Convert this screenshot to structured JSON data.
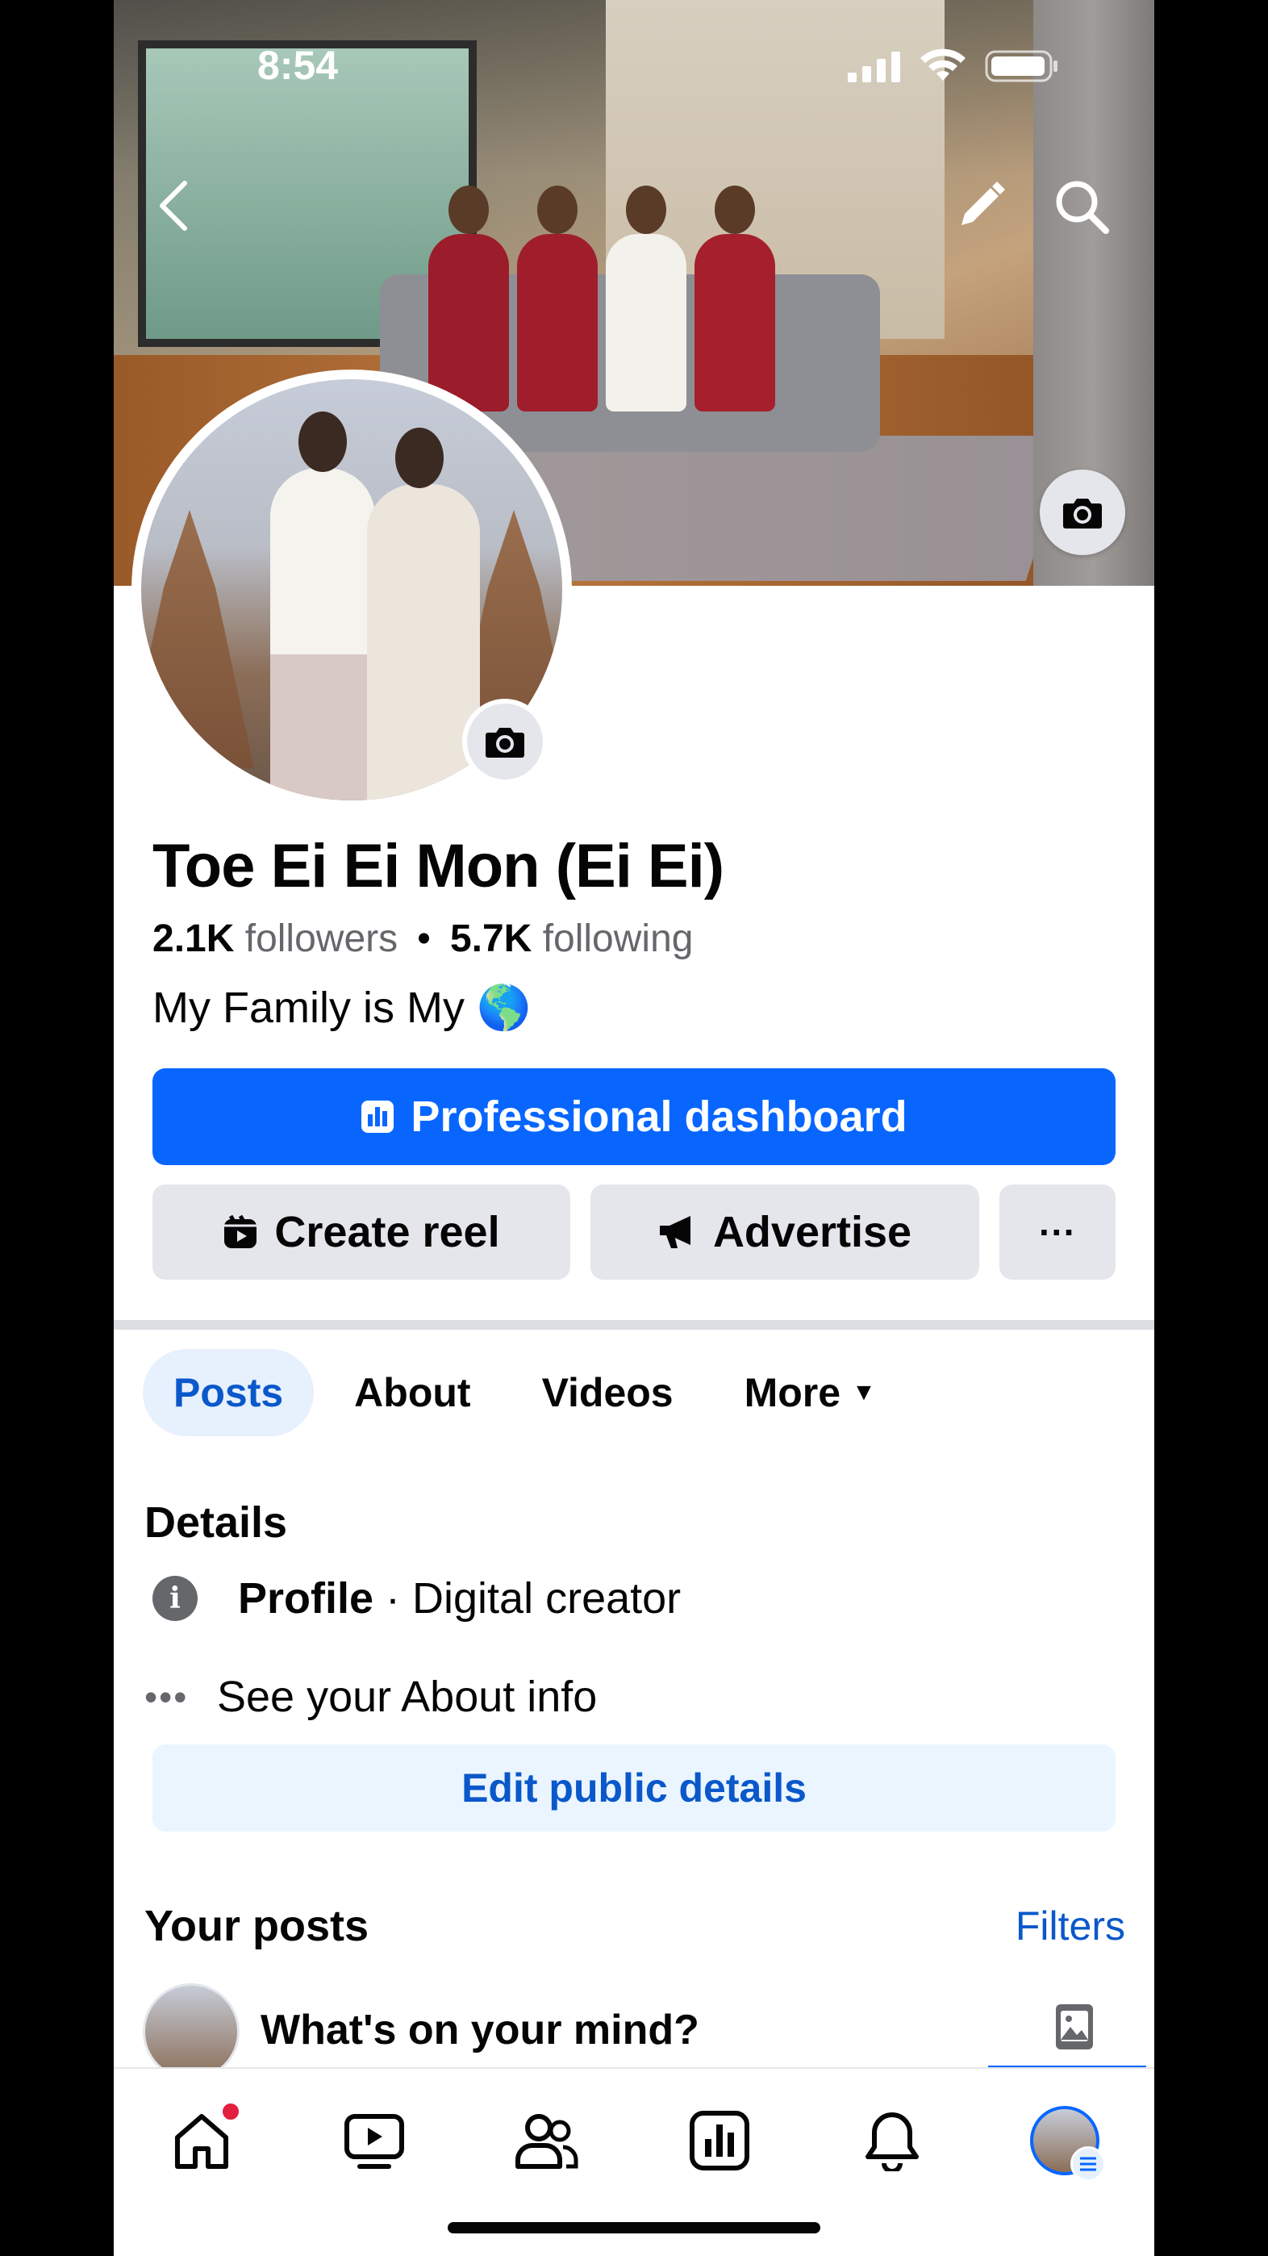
{
  "status_bar": {
    "time": "8:54"
  },
  "profile": {
    "name": "Toe Ei Ei Mon (Ei Ei)",
    "followers_count": "2.1K",
    "followers_label": "followers",
    "separator": "•",
    "following_count": "5.7K",
    "following_label": "following",
    "bio": "My Family is My 🌎"
  },
  "actions": {
    "professional_dashboard": "Professional dashboard",
    "create_reel": "Create reel",
    "advertise": "Advertise",
    "more": "···"
  },
  "tabs": [
    {
      "label": "Posts",
      "active": true
    },
    {
      "label": "About",
      "active": false
    },
    {
      "label": "Videos",
      "active": false
    },
    {
      "label": "More",
      "active": false
    }
  ],
  "details": {
    "title": "Details",
    "profile_label": "Profile",
    "profile_value": " · Digital creator",
    "about_link": "See your About info",
    "edit_button": "Edit public details"
  },
  "posts": {
    "title": "Your posts",
    "filters": "Filters",
    "composer_placeholder": "What's on your mind?"
  },
  "colors": {
    "accent": "#0866ff",
    "link": "#0a58ca",
    "secondary_button": "#e4e6eb",
    "notification_dot": "#e41e3f"
  },
  "bottom_nav": [
    {
      "icon": "home-icon",
      "label": ""
    },
    {
      "icon": "video-icon",
      "label": ""
    },
    {
      "icon": "friends-icon",
      "label": ""
    },
    {
      "icon": "dashboard-icon",
      "label": ""
    },
    {
      "icon": "bell-icon",
      "label": ""
    },
    {
      "icon": "profile-avatar-icon",
      "label": ""
    }
  ]
}
